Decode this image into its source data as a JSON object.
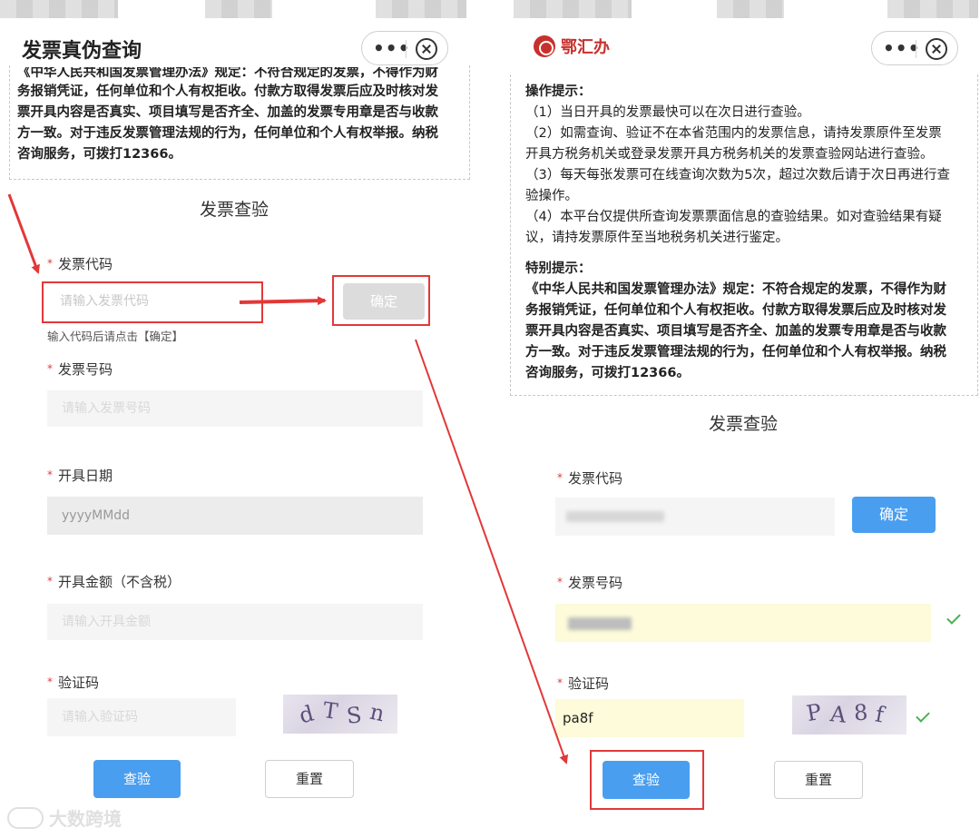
{
  "left": {
    "title": "发票真伪查询",
    "notice_lines": [
      "《中华人民共和国发票管理办法》规定：不符合规定的发票，不得作为财",
      "务报销凭证，任何单位和个人有权拒收。付款方取得发票后应及时核对发",
      "票开具内容是否真实、项目填写是否齐全、加盖的发票专用章是否与收款",
      "方一致。对于违反发票管理法规的行为，任何单位和个人有权举报。纳税",
      "咨询服务，可拨打12366。"
    ],
    "section_title": "发票查验",
    "required_mark": "*",
    "code_label": "发票代码",
    "code_placeholder": "请输入发票代码",
    "confirm_label": "确定",
    "code_hint": "输入代码后请点击【确定】",
    "number_label": "发票号码",
    "number_placeholder": "请输入发票号码",
    "date_label": "开具日期",
    "date_placeholder": "yyyyMMdd",
    "amount_label": "开具金额（不含税）",
    "amount_placeholder": "请输入开具金额",
    "captcha_label": "验证码",
    "captcha_placeholder": "请输入验证码",
    "captcha_chars": [
      "d",
      "T",
      "S",
      "n"
    ],
    "verify_label": "查验",
    "reset_label": "重置"
  },
  "right": {
    "brand": "鄂汇办",
    "tips_title": "操作提示：",
    "tips": [
      "（1）当日开具的发票最快可以在次日进行查验。",
      "（2）如需查询、验证不在本省范围内的发票信息，请持发票原件至发票",
      "开具方税务机关或登录发票开具方税务机关的发票查验网站进行查验。",
      "（3）每天每张发票可在线查询次数为5次，超过次数后请于次日再进行查",
      "验操作。",
      "（4）本平台仅提供所查询发票票面信息的查验结果。如对查验结果有疑",
      "议，请持发票原件至当地税务机关进行鉴定。"
    ],
    "special_title": "特别提示：",
    "special_lines": [
      "《中华人民共和国发票管理办法》规定：不符合规定的发票，不得作为财",
      "务报销凭证，任何单位和个人有权拒收。付款方取得发票后应及时核对发",
      "票开具内容是否真实、项目填写是否齐全、加盖的发票专用章是否与收款",
      "方一致。对于违反发票管理法规的行为，任何单位和个人有权举报。纳税",
      "咨询服务，可拨打12366。"
    ],
    "section_title": "发票查验",
    "required_mark": "*",
    "code_label": "发票代码",
    "confirm_label": "确定",
    "number_label": "发票号码",
    "captcha_label": "验证码",
    "captcha_value": "pa8f",
    "captcha_chars": [
      "P",
      "A",
      "8",
      "f"
    ],
    "verify_label": "查验",
    "reset_label": "重置"
  },
  "capsule_more": "•••",
  "watermark": "大数跨境",
  "colors": {
    "primary_blue": "#4a9eef",
    "annotation_red": "#e23838",
    "required_red": "#e23b3b",
    "valid_green": "#4caf50",
    "brand_red": "#c8302c"
  }
}
